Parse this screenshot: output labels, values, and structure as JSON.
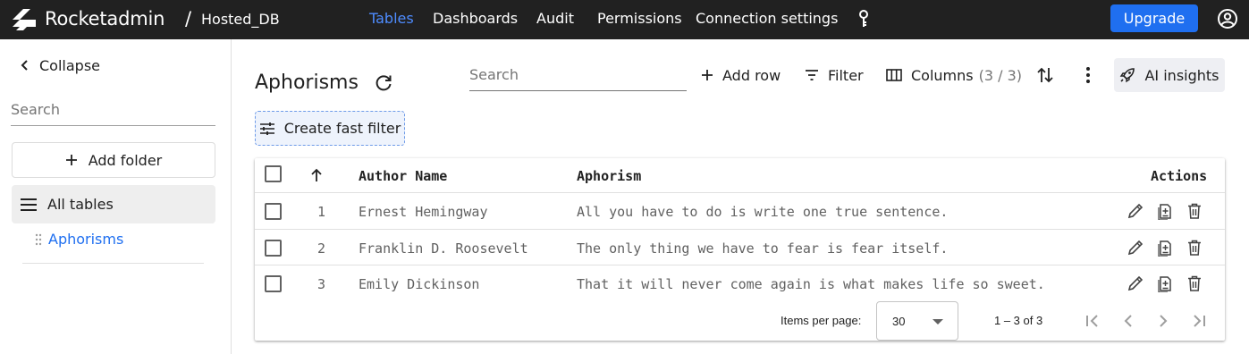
{
  "topbar": {
    "brand": "Rocketadmin",
    "separator": "/",
    "db_name": "Hosted_DB",
    "nav": [
      "Tables",
      "Dashboards",
      "Audit",
      "Permissions",
      "Connection settings"
    ],
    "active_nav": "Tables",
    "upgrade_label": "Upgrade",
    "accent": "#1f6ff0"
  },
  "sidebar": {
    "collapse_label": "Collapse",
    "search_placeholder": "Search",
    "add_folder_label": "Add folder",
    "all_tables_label": "All tables",
    "tables": [
      "Aphorisms"
    ]
  },
  "main": {
    "title": "Aphorisms",
    "search_placeholder": "Search",
    "add_row_label": "Add row",
    "filter_label": "Filter",
    "columns_label": "Columns",
    "columns_count": "(3 / 3)",
    "ai_label": "AI insights",
    "fast_filter_label": "Create fast filter"
  },
  "table": {
    "columns": [
      "Author Name",
      "Aphorism"
    ],
    "actions_header": "Actions",
    "rows": [
      {
        "id": "1",
        "author": "Ernest Hemingway",
        "aphorism": "All you have to do is write one true sentence."
      },
      {
        "id": "2",
        "author": "Franklin D. Roosevelt",
        "aphorism": "The only thing we have to fear is fear itself."
      },
      {
        "id": "3",
        "author": "Emily Dickinson",
        "aphorism": "That it will never come again is what makes life so sweet."
      }
    ]
  },
  "paginator": {
    "items_per_page_label": "Items per page:",
    "items_per_page": "30",
    "range_label": "1 – 3 of 3"
  },
  "icons": [
    "rocket-logo-icon",
    "key-icon",
    "account-circle-icon",
    "chevron-left-icon",
    "plus-icon",
    "menu-icon",
    "drag-handle-icon",
    "refresh-icon",
    "filter-icon",
    "columns-icon",
    "sort-icon",
    "more-vert-icon",
    "rocket-icon",
    "tune-icon",
    "arrow-up-icon",
    "edit-icon",
    "duplicate-icon",
    "delete-icon",
    "first-page-icon",
    "prev-page-icon",
    "next-page-icon",
    "last-page-icon"
  ]
}
